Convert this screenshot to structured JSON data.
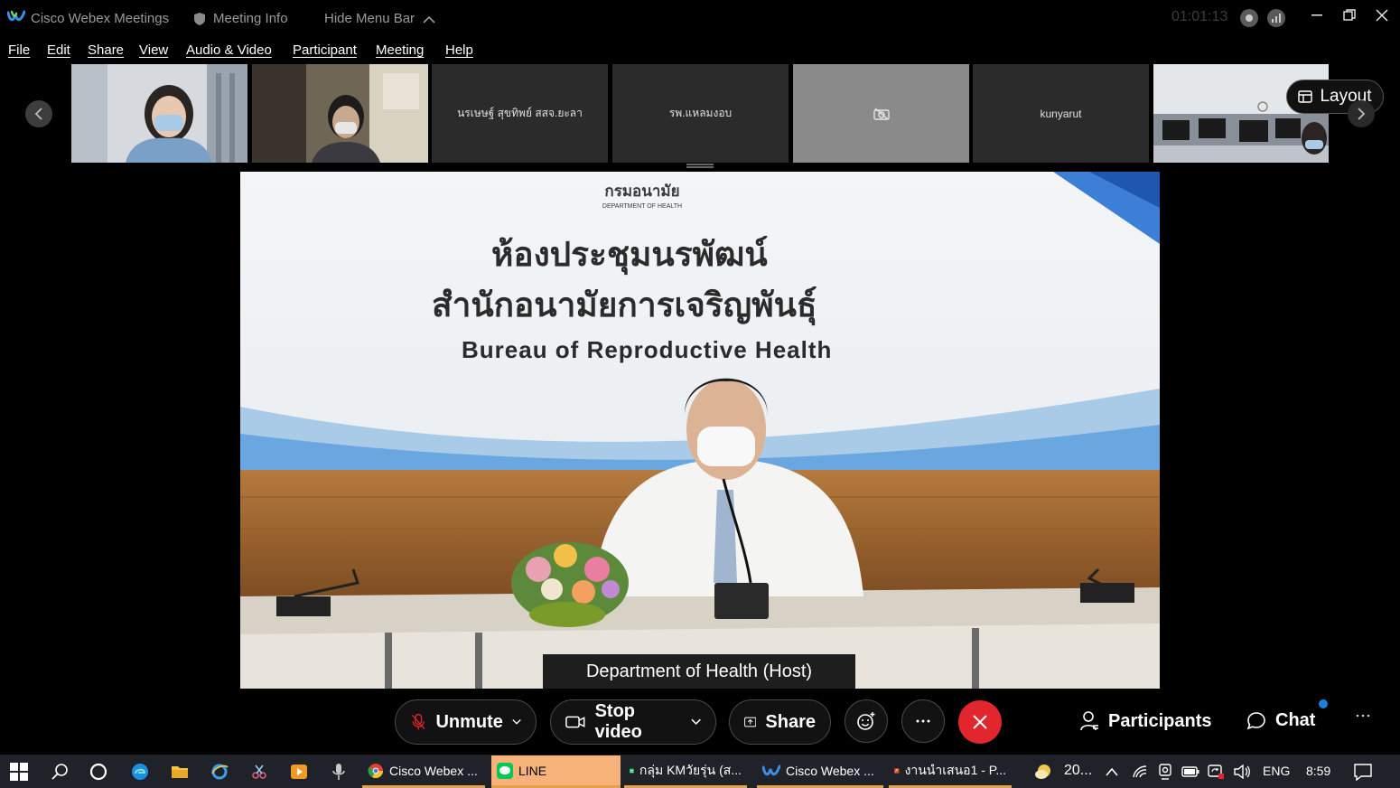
{
  "titlebar": {
    "app_title": "Cisco Webex Meetings",
    "meeting_info": "Meeting Info",
    "hide_menu": "Hide Menu Bar",
    "timer": "01:01:13"
  },
  "menu": [
    "File",
    "Edit",
    "Share",
    "View",
    "Audio & Video",
    "Participant",
    "Meeting",
    "Help"
  ],
  "filmstrip": {
    "participants": [
      {
        "label": "",
        "kind": "video-woman"
      },
      {
        "label": "",
        "kind": "video-man"
      },
      {
        "label": "นรเษษฐ์ สุขทิพย์ สสจ.ยะลา",
        "kind": "name"
      },
      {
        "label": "รพ.แหลมงอบ",
        "kind": "name"
      },
      {
        "label": "",
        "kind": "camera-off"
      },
      {
        "label": "kunyarut",
        "kind": "name"
      },
      {
        "label": "",
        "kind": "video-office"
      }
    ],
    "layout_label": "Layout"
  },
  "main_video": {
    "logo_text": "กรมอนามัย",
    "logo_sub": "DEPARTMENT OF HEALTH",
    "wall_line1": "ห้องประชุมนรพัฒน์",
    "wall_line2": "สำนักอนามัยการเจริญพันธุ์",
    "wall_line3": "Bureau of Reproductive Health",
    "speaker_label": "Department of Health (Host)"
  },
  "controls": {
    "unmute": "Unmute",
    "stop_video": "Stop video",
    "share": "Share",
    "participants": "Participants",
    "chat": "Chat"
  },
  "taskbar": {
    "tasks": [
      {
        "label": "Cisco Webex ..."
      },
      {
        "label": "LINE"
      },
      {
        "label": "กลุ่ม KMวัยรุ่น (ส..."
      },
      {
        "label": "Cisco Webex ..."
      },
      {
        "label": "งานนำเสนอ1 - P..."
      }
    ],
    "weather": "20...",
    "language": "ENG",
    "clock": "8:59"
  },
  "colors": {
    "leave_red": "#e1262d",
    "chat_badge": "#1a7fe0",
    "taskbar_bg": "#1f2228"
  }
}
